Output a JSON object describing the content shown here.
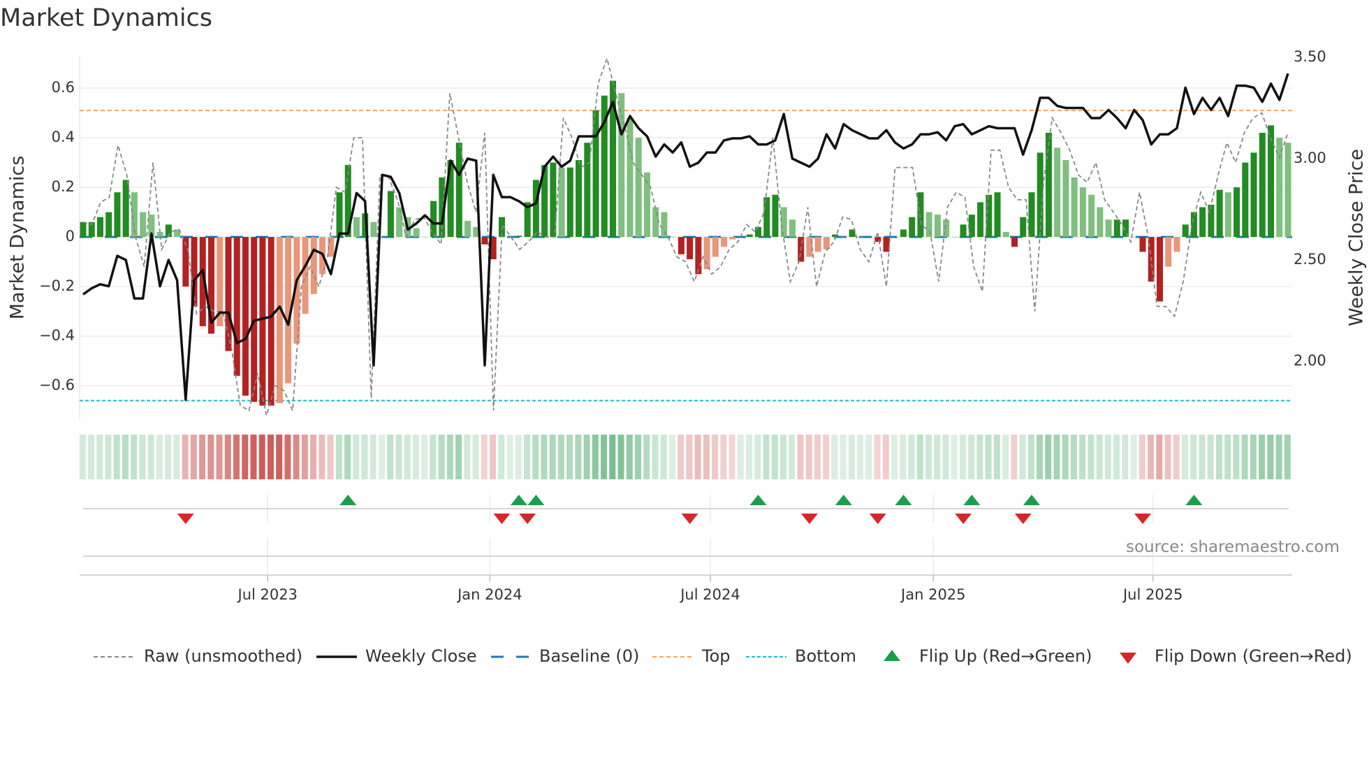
{
  "title": "Market Dynamics",
  "source": "source: sharemaestro.com",
  "legend": {
    "raw": "Raw (unsmoothed)",
    "close": "Weekly Close",
    "baseline": "Baseline (0)",
    "top": "Top",
    "bottom": "Bottom",
    "flip_up": "Flip Up (Red→Green)",
    "flip_down": "Flip Down (Green→Red)"
  },
  "colors": {
    "bar_strong_up": "#228b22",
    "bar_weak_up": "#7fbf7f",
    "bar_strong_down": "#b22222",
    "bar_weak_down": "#e9967a",
    "raw": "#888888",
    "close": "#111111",
    "baseline": "#1f77b4",
    "top": "#f4a460",
    "bottom": "#17becf",
    "flip_up": "#1a9e4a",
    "flip_down": "#d62728"
  },
  "chart_data": {
    "type": "bar+line",
    "title": "Market Dynamics",
    "ylabel": "Market Dynamics",
    "y2label": "Weekly Close Price",
    "ylim": [
      -0.735,
      0.73
    ],
    "y2lim": [
      1.79,
      3.5
    ],
    "yticks": [
      {
        "v": 0.6,
        "label": "0.6"
      },
      {
        "v": 0.4,
        "label": "0.4"
      },
      {
        "v": 0.2,
        "label": "0.2"
      },
      {
        "v": 0,
        "label": "0"
      },
      {
        "v": -0.2,
        "label": "−0.2"
      },
      {
        "v": -0.4,
        "label": "−0.4"
      },
      {
        "v": -0.6,
        "label": "−0.6"
      }
    ],
    "y2ticks": [
      {
        "v": 3.5,
        "label": "3.50"
      },
      {
        "v": 3.0,
        "label": "3.00"
      },
      {
        "v": 2.5,
        "label": "2.50"
      },
      {
        "v": 2.0,
        "label": "2.00"
      }
    ],
    "xticks": [
      {
        "week": 21.6,
        "label": "Jul 2023"
      },
      {
        "week": 47.6,
        "label": "Jan 2024"
      },
      {
        "week": 73.4,
        "label": "Jul 2024"
      },
      {
        "week": 99.5,
        "label": "Jan 2025"
      },
      {
        "week": 125.2,
        "label": "Jul 2025"
      }
    ],
    "top_level": 0.51,
    "bottom_level": -0.66,
    "baseline": 0,
    "bars": [
      0.06,
      0.06,
      0.08,
      0.1,
      0.18,
      0.23,
      0.18,
      0.1,
      0.09,
      0.02,
      0.05,
      0.03,
      -0.2,
      -0.28,
      -0.36,
      -0.39,
      -0.36,
      -0.46,
      -0.56,
      -0.64,
      -0.665,
      -0.68,
      -0.68,
      -0.67,
      -0.59,
      -0.43,
      -0.31,
      -0.23,
      -0.15,
      -0.08,
      0.18,
      0.29,
      0.08,
      0.095,
      0.06,
      0.0,
      0.185,
      0.12,
      0.08,
      0.035,
      0.0,
      0.145,
      0.24,
      0.31,
      0.38,
      0.065,
      0.04,
      -0.03,
      -0.09,
      0.08,
      0.0,
      0.005,
      0.14,
      0.23,
      0.29,
      0.3,
      0.28,
      0.28,
      0.31,
      0.38,
      0.51,
      0.57,
      0.63,
      0.58,
      0.48,
      0.4,
      0.26,
      0.12,
      0.1,
      0.0,
      -0.07,
      -0.09,
      -0.15,
      -0.13,
      -0.08,
      -0.04,
      -0.01,
      0,
      0.01,
      0.04,
      0.16,
      0.17,
      0.12,
      0.07,
      -0.1,
      -0.08,
      -0.06,
      -0.05,
      0.01,
      0,
      0.03,
      0,
      0,
      -0.02,
      -0.06,
      0,
      0.03,
      0.08,
      0.18,
      0.1,
      0.09,
      0.07,
      0,
      0.05,
      0.09,
      0.14,
      0.17,
      0.18,
      0.02,
      -0.04,
      0.08,
      0.18,
      0.34,
      0.42,
      0.36,
      0.31,
      0.24,
      0.2,
      0.17,
      0.12,
      0.07,
      0.07,
      0.07,
      0,
      -0.06,
      -0.18,
      -0.26,
      -0.12,
      -0.06,
      0.05,
      0.1,
      0.12,
      0.13,
      0.19,
      0.18,
      0.2,
      0.3,
      0.34,
      0.42,
      0.45,
      0.4,
      0.38
    ],
    "raw": [
      0.06,
      0.05,
      0.14,
      0.16,
      0.37,
      0.25,
      0.0,
      -0.12,
      0.3,
      -0.05,
      0.02,
      0.03,
      -0.05,
      -0.31,
      -0.28,
      -0.3,
      -0.3,
      -0.45,
      -0.68,
      -0.7,
      -0.55,
      -0.72,
      -0.6,
      -0.62,
      -0.7,
      -0.2,
      -0.12,
      -0.2,
      -0.08,
      0.2,
      0.18,
      0.4,
      0.4,
      -0.65,
      0.25,
      0.24,
      0.15,
      0.0,
      0.07,
      0.08,
      0.02,
      -0.03,
      0.58,
      0.4,
      0.22,
      0.1,
      0.42,
      -0.7,
      0.05,
      0.0,
      -0.05,
      -0.02,
      0.02,
      0.0,
      0.0,
      0.48,
      0.4,
      0.28,
      0.3,
      0.62,
      0.72,
      0.58,
      0.45,
      0.3,
      0.25,
      0.2,
      0.05,
      0.0,
      -0.08,
      -0.1,
      -0.18,
      -0.08,
      -0.15,
      -0.12,
      -0.05,
      -0.02,
      0.05,
      0.02,
      0.1,
      0.4,
      0.05,
      -0.18,
      -0.1,
      0.12,
      -0.2,
      -0.06,
      -0.02,
      0.08,
      0.07,
      -0.05,
      -0.1,
      0.02,
      -0.2,
      0.28,
      0.28,
      0.28,
      0.05,
      0.02,
      -0.18,
      0.12,
      0.18,
      0.16,
      -0.12,
      -0.22,
      0.35,
      0.35,
      0.2,
      0.15,
      0.15,
      -0.3,
      0.22,
      0.48,
      0.42,
      0.35,
      0.25,
      0.22,
      0.3,
      0.15,
      0.1,
      0.05,
      -0.02,
      0.18,
      0.0,
      -0.28,
      -0.28,
      -0.32,
      -0.18,
      0.05,
      0.18,
      0.1,
      0.25,
      0.38,
      0.3,
      0.42,
      0.48,
      0.5,
      0.4,
      0.32,
      0.42
    ],
    "close": [
      2.33,
      2.36,
      2.38,
      2.37,
      2.52,
      2.5,
      2.31,
      2.31,
      2.63,
      2.37,
      2.5,
      2.4,
      1.81,
      2.4,
      2.45,
      2.19,
      2.24,
      2.24,
      2.09,
      2.11,
      2.2,
      2.21,
      2.22,
      2.27,
      2.18,
      2.4,
      2.47,
      2.55,
      2.53,
      2.43,
      2.63,
      2.63,
      2.83,
      2.79,
      1.98,
      2.92,
      2.91,
      2.83,
      2.65,
      2.68,
      2.72,
      2.68,
      2.68,
      2.99,
      2.92,
      3.0,
      2.99,
      1.98,
      2.92,
      2.81,
      2.81,
      2.79,
      2.76,
      2.78,
      2.96,
      3.01,
      2.96,
      2.99,
      3.11,
      3.11,
      3.11,
      3.18,
      3.28,
      3.12,
      3.21,
      3.15,
      3.11,
      3.01,
      3.07,
      3.03,
      3.08,
      2.96,
      2.98,
      3.03,
      3.03,
      3.09,
      3.1,
      3.1,
      3.11,
      3.07,
      3.07,
      3.09,
      3.22,
      3.0,
      2.98,
      2.96,
      3.0,
      3.12,
      3.05,
      3.17,
      3.14,
      3.12,
      3.1,
      3.1,
      3.14,
      3.08,
      3.05,
      3.07,
      3.12,
      3.12,
      3.13,
      3.09,
      3.16,
      3.17,
      3.12,
      3.14,
      3.16,
      3.15,
      3.15,
      3.15,
      3.02,
      3.14,
      3.3,
      3.3,
      3.26,
      3.25,
      3.25,
      3.25,
      3.2,
      3.2,
      3.24,
      3.2,
      3.15,
      3.24,
      3.19,
      3.07,
      3.12,
      3.12,
      3.15,
      3.35,
      3.22,
      3.3,
      3.24,
      3.3,
      3.21,
      3.36,
      3.36,
      3.35,
      3.28,
      3.37,
      3.29,
      3.42
    ],
    "flip_up_weeks": [
      31,
      51,
      53,
      79,
      89,
      96,
      104,
      111,
      130
    ],
    "flip_down_weeks": [
      12,
      49,
      52,
      71,
      85,
      93,
      103,
      110,
      124
    ],
    "legend_position": "bottom"
  }
}
